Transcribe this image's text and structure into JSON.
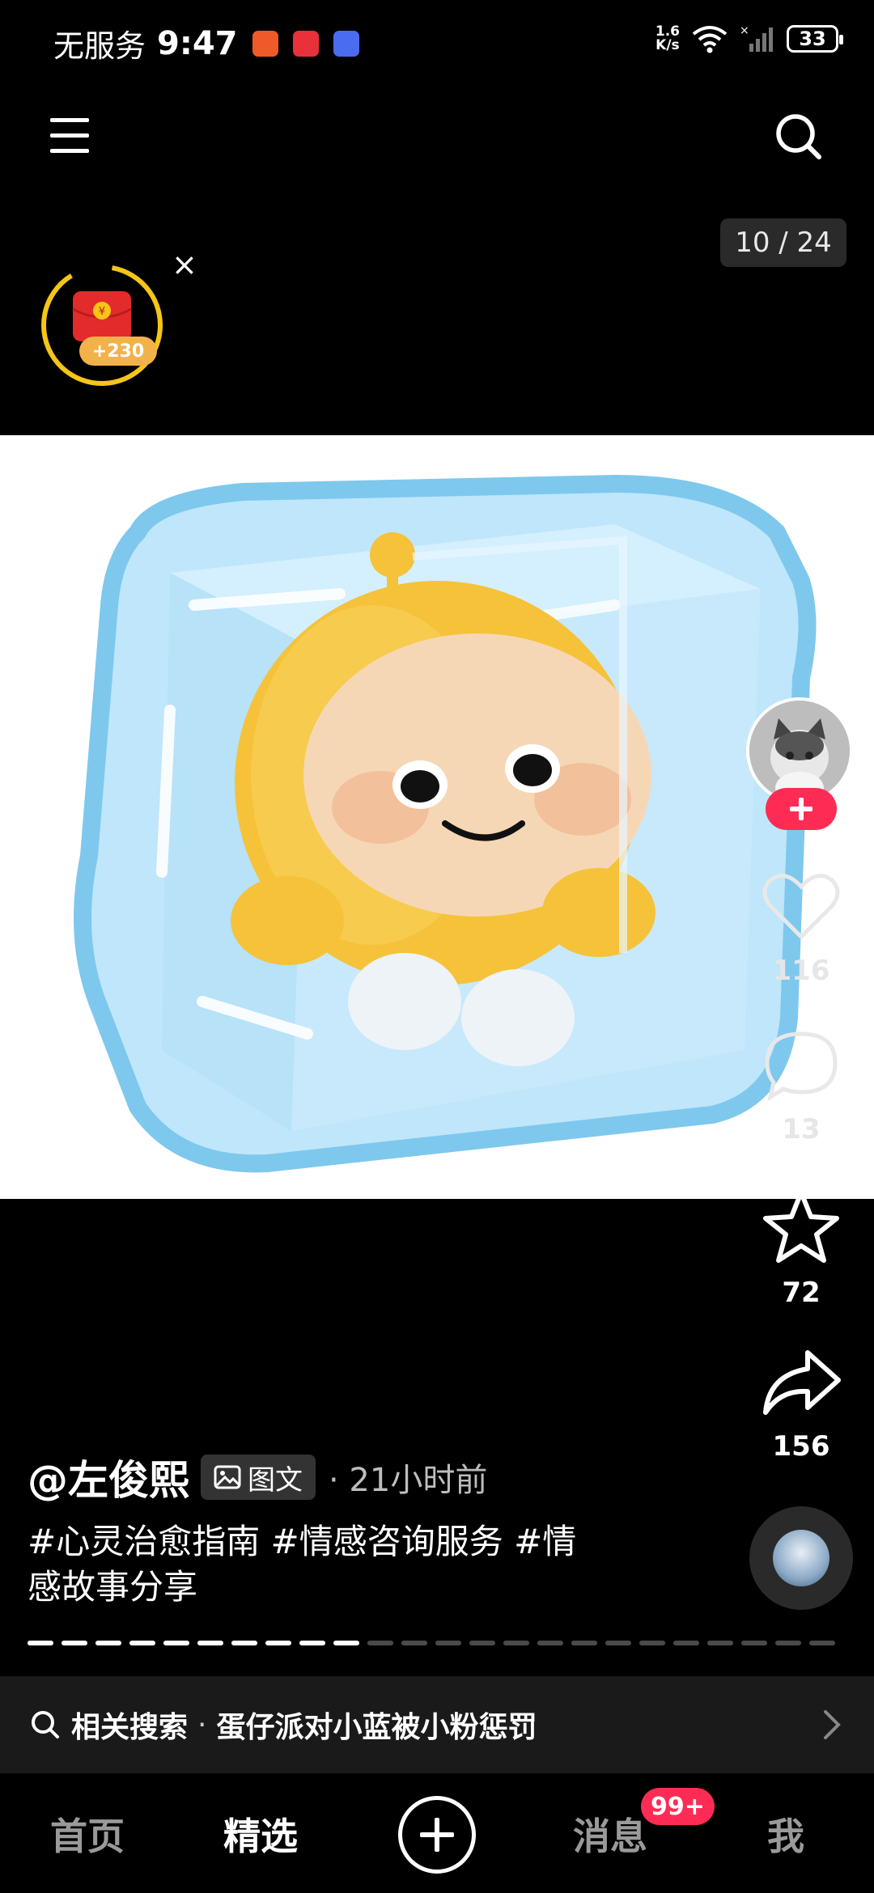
{
  "status_bar": {
    "carrier": "无服务",
    "time": "9:47",
    "net_speed_top": "1.6",
    "net_speed_bottom": "K/s",
    "battery": "33"
  },
  "reward": {
    "badge": "+230"
  },
  "page_counter": "10 / 24",
  "post": {
    "author": "@左俊熙",
    "type_tag": "图文",
    "time_ago": "· 21小时前",
    "caption": "#心灵治愈指南 #情感咨询服务 #情感故事分享"
  },
  "actions": {
    "likes": "116",
    "comments": "13",
    "favorites": "72",
    "shares": "156"
  },
  "related_search": {
    "label": "相关搜索",
    "separator": "·",
    "query": "蛋仔派对小蓝被小粉惩罚"
  },
  "bottom_nav": {
    "home": "首页",
    "featured": "精选",
    "messages": "消息",
    "me": "我",
    "messages_badge": "99+"
  },
  "progress": {
    "current": 10,
    "total": 24
  },
  "colors": {
    "accent": "#fe2c55",
    "ice": "#7ec8ee",
    "character": "#f5c23a"
  }
}
